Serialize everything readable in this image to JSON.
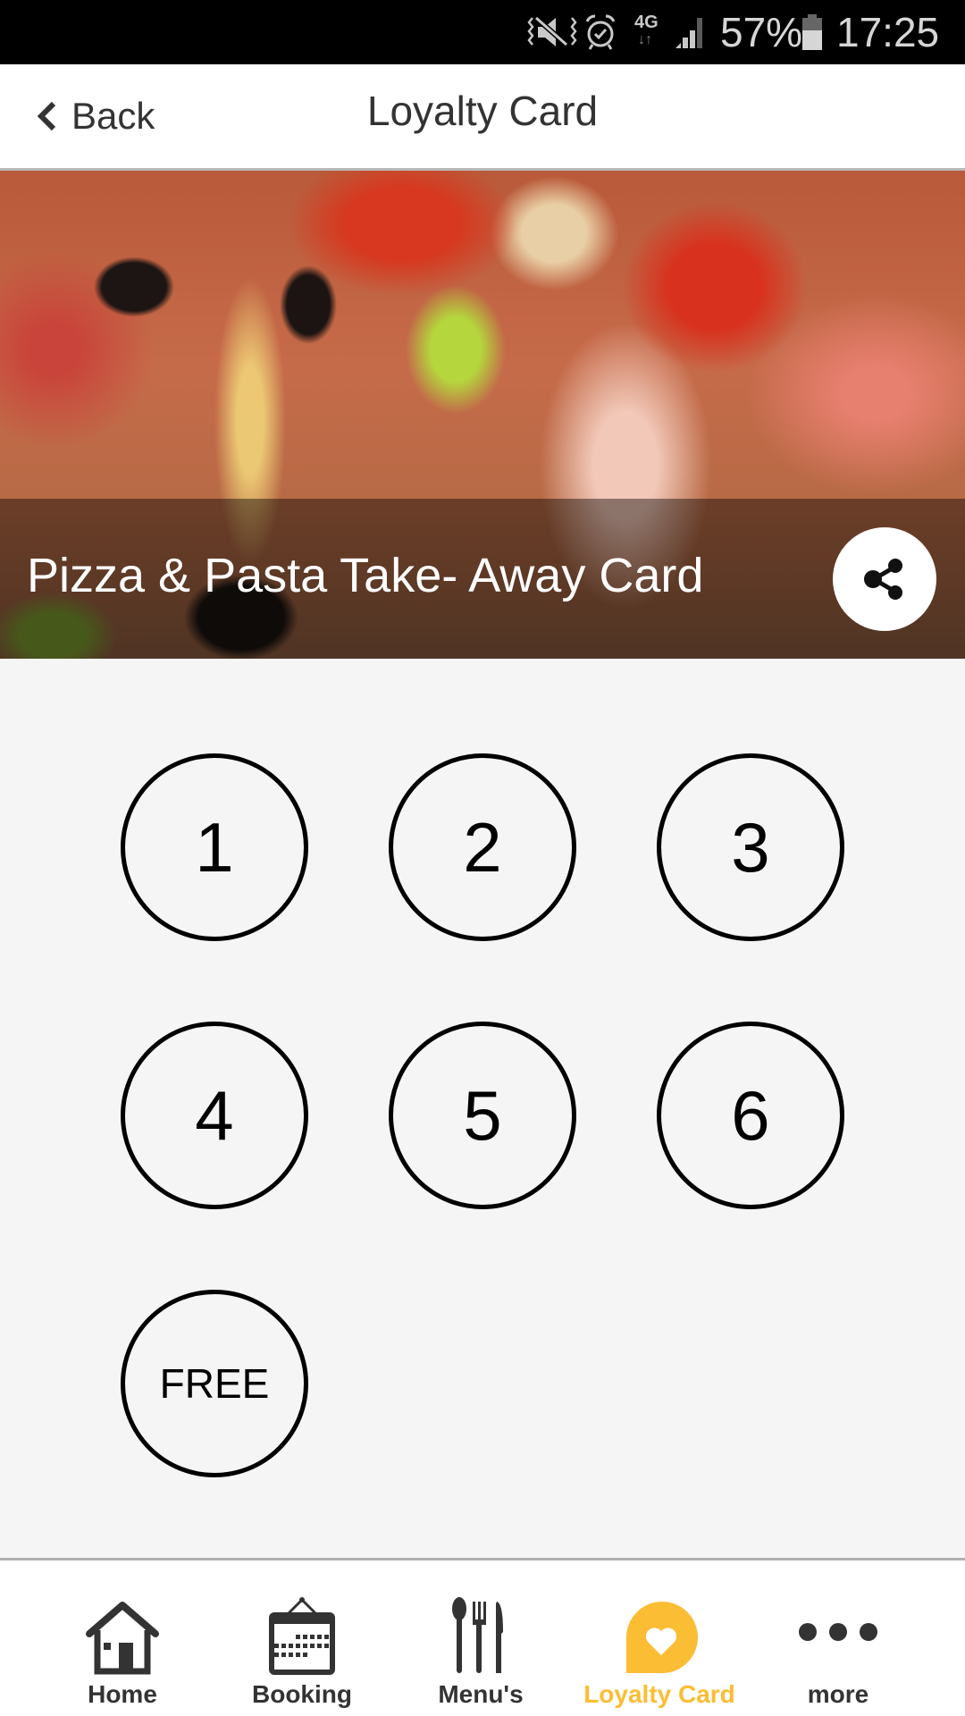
{
  "status_bar": {
    "icons": [
      "vibrate-mute-icon",
      "alarm-icon",
      "network-4g-icon",
      "signal-icon",
      "battery-icon"
    ],
    "network_label": "4G",
    "battery": "57%",
    "time": "17:25"
  },
  "header": {
    "back_label": "Back",
    "title": "Loyalty Card"
  },
  "banner": {
    "title": "Pizza & Pasta Take- Away Card",
    "share_icon": "share-icon"
  },
  "loyalty_card": {
    "stamps": [
      {
        "label": "1",
        "stamped": false
      },
      {
        "label": "2",
        "stamped": false
      },
      {
        "label": "3",
        "stamped": false
      },
      {
        "label": "4",
        "stamped": false
      },
      {
        "label": "5",
        "stamped": false
      },
      {
        "label": "6",
        "stamped": false
      },
      {
        "label": "FREE",
        "stamped": false
      }
    ]
  },
  "tabbar": {
    "active_color": "#fbbd33",
    "items": [
      {
        "label": "Home",
        "icon": "home-icon",
        "active": false
      },
      {
        "label": "Booking",
        "icon": "calendar-icon",
        "active": false
      },
      {
        "label": "Menu's",
        "icon": "cutlery-icon",
        "active": false
      },
      {
        "label": "Loyalty Card",
        "icon": "loyalty-heart-icon",
        "active": true
      },
      {
        "label": "more",
        "icon": "more-dots-icon",
        "active": false
      }
    ]
  }
}
